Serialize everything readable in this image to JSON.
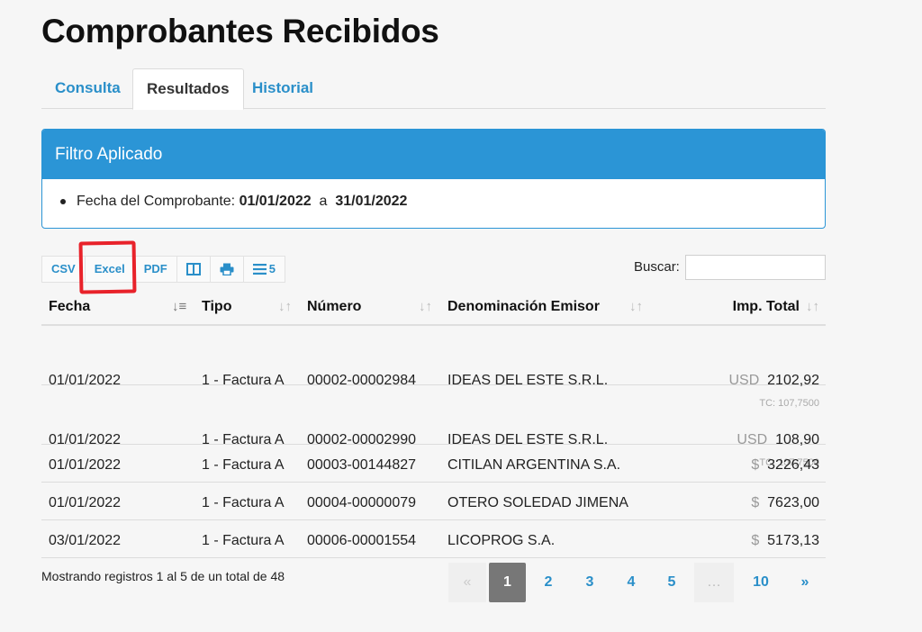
{
  "page_title": "Comprobantes Recibidos",
  "tabs": [
    {
      "label": "Consulta",
      "active": false
    },
    {
      "label": "Resultados",
      "active": true
    },
    {
      "label": "Historial",
      "active": false
    }
  ],
  "filter": {
    "title": "Filtro Aplicado",
    "label": "Fecha del Comprobante:",
    "from": "01/01/2022",
    "separator": "a",
    "to": "31/01/2022"
  },
  "toolbar": {
    "csv": "CSV",
    "excel": "Excel",
    "pdf": "PDF",
    "columns_icon": "columns-icon",
    "print_icon": "print-icon",
    "rows_icon": "list-icon",
    "rows_count": "5"
  },
  "search": {
    "label": "Buscar:",
    "value": ""
  },
  "table": {
    "headers": [
      "Fecha",
      "Tipo",
      "Número",
      "Denominación Emisor",
      "Imp. Total"
    ],
    "rows": [
      {
        "fecha": "01/01/2022",
        "tipo": "1 - Factura A",
        "numero": "00002-00002984",
        "emisor": "IDEAS DEL ESTE S.R.L.",
        "currency": "USD",
        "total": "2102,92",
        "tc": "TC: 107,7500"
      },
      {
        "fecha": "01/01/2022",
        "tipo": "1 - Factura A",
        "numero": "00002-00002990",
        "emisor": "IDEAS DEL ESTE S.R.L.",
        "currency": "USD",
        "total": "108,90",
        "tc": "TC: 107,7500"
      },
      {
        "fecha": "01/01/2022",
        "tipo": "1 - Factura A",
        "numero": "00003-00144827",
        "emisor": "CITILAN ARGENTINA S.A.",
        "currency": "$",
        "total": "3226,43",
        "tc": ""
      },
      {
        "fecha": "01/01/2022",
        "tipo": "1 - Factura A",
        "numero": "00004-00000079",
        "emisor": "OTERO SOLEDAD JIMENA",
        "currency": "$",
        "total": "7623,00",
        "tc": ""
      },
      {
        "fecha": "03/01/2022",
        "tipo": "1 - Factura A",
        "numero": "00006-00001554",
        "emisor": "LICOPROG S.A.",
        "currency": "$",
        "total": "5173,13",
        "tc": ""
      }
    ]
  },
  "info": "Mostrando registros 1 al 5 de un total de 48",
  "pagination": {
    "prev": "«",
    "pages": [
      "1",
      "2",
      "3",
      "4",
      "5"
    ],
    "ellipsis": "…",
    "last": "10",
    "next": "»",
    "current": "1"
  },
  "colors": {
    "accent": "#2b95d6",
    "link": "#2a8fc9",
    "annotation": "#e8222a",
    "current_page": "#777777"
  }
}
